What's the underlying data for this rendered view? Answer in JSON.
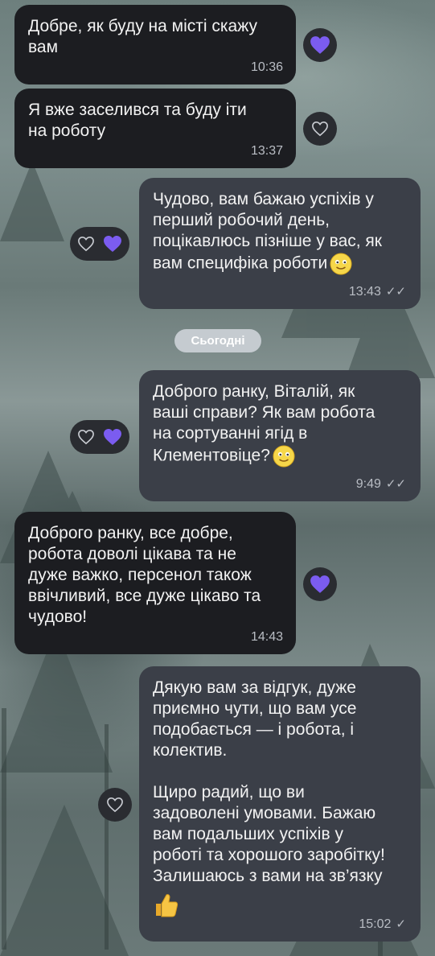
{
  "date_separator": "Сьогодні",
  "messages": [
    {
      "text": "Добре, як буду на місті скажу\nвам",
      "time": "10:36"
    },
    {
      "text": "Я вже заселився та буду іти\nна роботу",
      "time": "13:37"
    },
    {
      "text": "Чудово, вам бажаю успіхів у\nперший робочий день,\nпоцікавлюсь пізніше у вас, як\nвам специфіка роботи",
      "time": "13:43"
    },
    {
      "text": "Доброго ранку, Віталій, як\nваші справи? Як вам робота\nна сортуванні ягід в\nКлементовіце?",
      "time": "9:49"
    },
    {
      "text": "Доброго ранку, все добре,\nробота доволі цікава та не\nдуже важко, персенол також\nввічливий, все дуже цікаво та\nчудово!",
      "time": "14:43"
    },
    {
      "text": "Дякую вам за відгук, дуже\nприємно чути, що вам усе\nподобається — і робота, і\nколектив.\n\nЩиро радий, що ви\nзадоволені умовами. Бажаю\nвам подальших успіхів у\nроботі та хорошого заробітку!\nЗалишаюсь з вами на зв’язку",
      "time": "15:02"
    }
  ],
  "colors": {
    "incoming_bubble": "#1c1d21",
    "outgoing_bubble": "#3b3f48",
    "heart_filled": "#7b5cf0",
    "heart_outline": "#c9ccd2"
  },
  "icons": {
    "smile": "smiling-face-emoji",
    "thumbs_up": "thumbs-up-emoji",
    "heart_filled": "filled-heart-icon",
    "heart_outline": "outline-heart-icon",
    "read_receipt": "double-check-icon",
    "sent_receipt": "single-check-icon"
  }
}
